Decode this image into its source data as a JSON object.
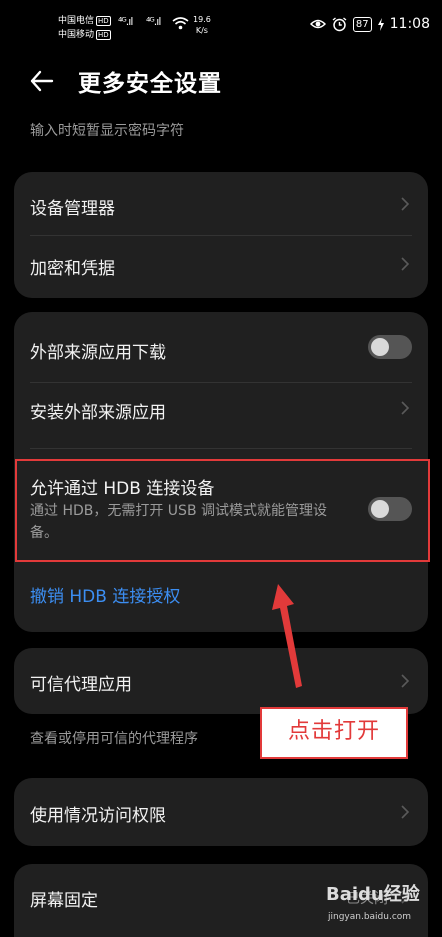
{
  "status_bar": {
    "carrier_1": "中国电信",
    "carrier_2": "中国移动",
    "hd_badge": "HD",
    "signal_1": "⁴ᴳ.ıl",
    "signal_2": "⁴ᴳ.ıl",
    "speed_value": "19.6",
    "speed_unit": "K/s",
    "battery": "87",
    "time": "11:08"
  },
  "header": {
    "title": "更多安全设置"
  },
  "top_tip": "输入时短暂显示密码字符",
  "card_1": {
    "items": [
      {
        "label": "设备管理器"
      },
      {
        "label": "加密和凭据"
      }
    ]
  },
  "card_2": {
    "external_download": {
      "label": "外部来源应用下载",
      "enabled": false
    },
    "install_external": {
      "label": "安装外部来源应用"
    },
    "hdb_allow": {
      "label": "允许通过 HDB 连接设备",
      "description": "通过 HDB，无需打开 USB 调试模式就能管理设备。",
      "enabled": false
    },
    "revoke_hdb": {
      "label": "撤销 HDB 连接授权"
    }
  },
  "card_3": {
    "trusted_agents": {
      "label": "可信代理应用"
    }
  },
  "trusted_agents_tip": "查看或停用可信的代理程序",
  "card_4": {
    "usage_access": {
      "label": "使用情况访问权限"
    }
  },
  "card_5": {
    "screen_pinning": {
      "label": "屏幕固定",
      "value": "已关闭"
    }
  },
  "annotation": {
    "text": "点击打开",
    "color": "#e23a3a"
  },
  "watermark": {
    "brand": "Baidu经验",
    "url": "jingyan.baidu.com"
  },
  "colors": {
    "link": "#3c8ef2",
    "card": "#202020",
    "background": "#000000"
  }
}
